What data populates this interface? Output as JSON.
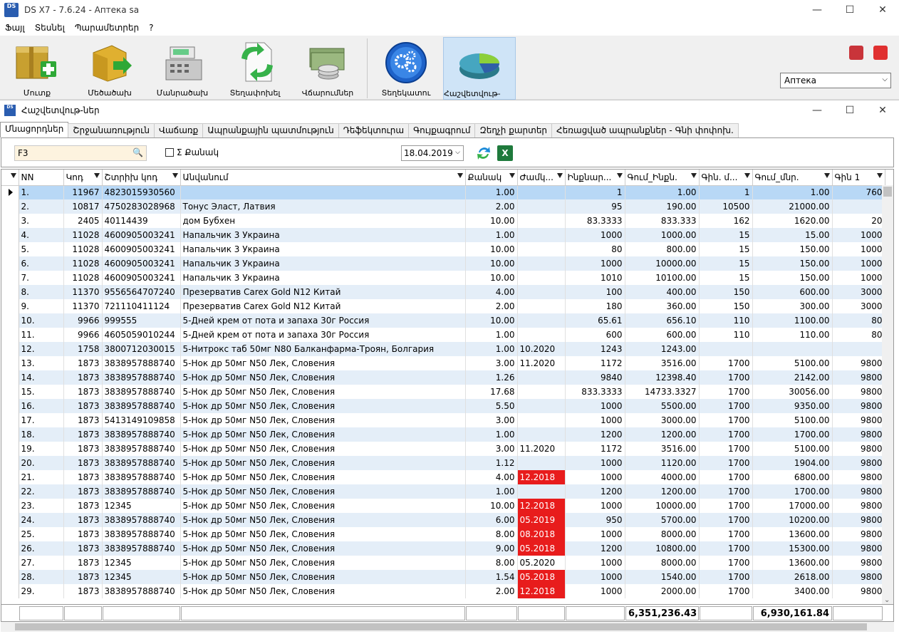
{
  "window": {
    "title": "DS X7 - 7.6.24 - Аптека sa",
    "logo": "DS",
    "controls": [
      "minimize-icon",
      "maximize-icon",
      "close-icon"
    ]
  },
  "menu": [
    "Ֆայլ",
    "Տեսնել",
    "Պարամետրեր",
    "?"
  ],
  "toolbar": [
    {
      "label": "Մուտք",
      "icon": "box-add-icon"
    },
    {
      "label": "Մեծածախ",
      "icon": "box-arrow-icon"
    },
    {
      "label": "Մանրածախ",
      "icon": "cash-register-icon"
    },
    {
      "label": "Տեղափոխել",
      "icon": "document-transfer-icon"
    },
    {
      "label": "Վճարումներ",
      "icon": "money-coins-icon"
    },
    {
      "label": "Տեղեկատու",
      "icon": "gears-icon"
    },
    {
      "label": "Հաշվետվութ-ներ",
      "icon": "pie-chart-icon",
      "active": true
    }
  ],
  "pharmacy_select": "Аптека",
  "child": {
    "title": "Հաշվետվութ-ներ"
  },
  "tabs": [
    "Մնացորդներ",
    "Շրջանառություն",
    "Վաճառք",
    "Ապրանքային պատմություն",
    "Դեֆեկտուրա",
    "Գույքագրում",
    "Զեղչի քարտեր",
    "Հեռացված ապրանքներ - Գնի փոփոխ."
  ],
  "filter": {
    "search_value": "F3",
    "sum_label": "Σ Քանակ",
    "date": "18.04.2019"
  },
  "columns": [
    "NN",
    "Կոդ",
    "Շտրիխ կոդ",
    "Անվանում",
    "Քանակ",
    "Ժամկ...",
    "Ինքնար...",
    "Գում_Ինքն.",
    "Գին. մ...",
    "Գում_մնր.",
    "Գին 1"
  ],
  "rows": [
    [
      "1.",
      "11967",
      "4823015930560",
      "",
      "1.00",
      "",
      "1",
      "1.00",
      "1",
      "1.00",
      "760"
    ],
    [
      "2.",
      "10817",
      "4750283028968",
      " Тонус Эласт, Латвия",
      "2.00",
      "",
      "95",
      "190.00",
      "10500",
      "21000.00",
      ""
    ],
    [
      "3.",
      "2405",
      "40114439",
      " дом  Бубхен",
      "10.00",
      "",
      "83.3333",
      "833.333",
      "162",
      "1620.00",
      "20"
    ],
    [
      "4.",
      "11028",
      "4600905003241",
      "Напальчик 3 Украина",
      "1.00",
      "",
      "1000",
      "1000.00",
      "15",
      "15.00",
      "1000"
    ],
    [
      "5.",
      "11028",
      "4600905003241",
      "Напальчик 3 Украина",
      "10.00",
      "",
      "80",
      "800.00",
      "15",
      "150.00",
      "1000"
    ],
    [
      "6.",
      "11028",
      "4600905003241",
      "Напальчик 3 Украина",
      "10.00",
      "",
      "1000",
      "10000.00",
      "15",
      "150.00",
      "1000"
    ],
    [
      "7.",
      "11028",
      "4600905003241",
      "Напальчик 3 Украина",
      "10.00",
      "",
      "1010",
      "10100.00",
      "15",
      "150.00",
      "1000"
    ],
    [
      "8.",
      "11370",
      "9556564707240",
      "Презерватив Carex Gold N12  Китай",
      "4.00",
      "",
      "100",
      "400.00",
      "150",
      "600.00",
      "3000"
    ],
    [
      "9.",
      "11370",
      "721110411124",
      "Презерватив Carex Gold N12  Китай",
      "2.00",
      "",
      "180",
      "360.00",
      "150",
      "300.00",
      "3000"
    ],
    [
      "10.",
      "9966",
      "999555",
      "5-Дней  крем  от  пота  и  запаха  30г  Россия",
      "10.00",
      "",
      "65.61",
      "656.10",
      "110",
      "1100.00",
      "80"
    ],
    [
      "11.",
      "9966",
      "4605059010244",
      "5-Дней  крем  от  пота  и  запаха  30г  Россия",
      "1.00",
      "",
      "600",
      "600.00",
      "110",
      "110.00",
      "80"
    ],
    [
      "12.",
      "1758",
      "3800712030015",
      "5-Нитрокс таб 50мг  N80  Балканфарма-Троян, Болгария",
      "1.00",
      "10.2020",
      "1243",
      "1243.00",
      "",
      "",
      ""
    ],
    [
      "13.",
      "1873",
      "3838957888740",
      "5-Нок др 50мг N50  Лек, Словения",
      "3.00",
      "11.2020",
      "1172",
      "3516.00",
      "1700",
      "5100.00",
      "9800"
    ],
    [
      "14.",
      "1873",
      "3838957888740",
      "5-Нок др 50мг N50  Лек, Словения",
      "1.26",
      "",
      "9840",
      "12398.40",
      "1700",
      "2142.00",
      "9800"
    ],
    [
      "15.",
      "1873",
      "3838957888740",
      "5-Нок др 50мг N50  Лек, Словения",
      "17.68",
      "",
      "833.3333",
      "14733.3327",
      "1700",
      "30056.00",
      "9800"
    ],
    [
      "16.",
      "1873",
      "3838957888740",
      "5-Нок др 50мг N50  Лек, Словения",
      "5.50",
      "",
      "1000",
      "5500.00",
      "1700",
      "9350.00",
      "9800"
    ],
    [
      "17.",
      "1873",
      "5413149109858",
      "5-Нок др 50мг N50  Лек, Словения",
      "3.00",
      "",
      "1000",
      "3000.00",
      "1700",
      "5100.00",
      "9800"
    ],
    [
      "18.",
      "1873",
      "3838957888740",
      "5-Нок др 50мг N50  Лек, Словения",
      "1.00",
      "",
      "1200",
      "1200.00",
      "1700",
      "1700.00",
      "9800"
    ],
    [
      "19.",
      "1873",
      "3838957888740",
      "5-Нок др 50мг N50  Лек, Словения",
      "3.00",
      "11.2020",
      "1172",
      "3516.00",
      "1700",
      "5100.00",
      "9800"
    ],
    [
      "20.",
      "1873",
      "3838957888740",
      "5-Нок др 50мг N50  Лек, Словения",
      "1.12",
      "",
      "1000",
      "1120.00",
      "1700",
      "1904.00",
      "9800"
    ],
    [
      "21.",
      "1873",
      "3838957888740",
      "5-Нок др 50мг N50  Лек, Словения",
      "4.00",
      "12.2018",
      "1000",
      "4000.00",
      "1700",
      "6800.00",
      "9800"
    ],
    [
      "22.",
      "1873",
      "3838957888740",
      "5-Нок др 50мг N50  Лек, Словения",
      "1.00",
      "",
      "1200",
      "1200.00",
      "1700",
      "1700.00",
      "9800"
    ],
    [
      "23.",
      "1873",
      "12345",
      "5-Нок др 50мг N50  Лек, Словения",
      "10.00",
      "12.2018",
      "1000",
      "10000.00",
      "1700",
      "17000.00",
      "9800"
    ],
    [
      "24.",
      "1873",
      "3838957888740",
      "5-Нок др 50мг N50  Лек, Словения",
      "6.00",
      "05.2019",
      "950",
      "5700.00",
      "1700",
      "10200.00",
      "9800"
    ],
    [
      "25.",
      "1873",
      "3838957888740",
      "5-Нок др 50мг N50  Лек, Словения",
      "8.00",
      "08.2018",
      "1000",
      "8000.00",
      "1700",
      "13600.00",
      "9800"
    ],
    [
      "26.",
      "1873",
      "3838957888740",
      "5-Нок др 50мг N50  Лек, Словения",
      "9.00",
      "05.2018",
      "1200",
      "10800.00",
      "1700",
      "15300.00",
      "9800"
    ],
    [
      "27.",
      "1873",
      "12345",
      "5-Нок др 50мг N50  Лек, Словения",
      "8.00",
      "05.2020",
      "1000",
      "8000.00",
      "1700",
      "13600.00",
      "9800"
    ],
    [
      "28.",
      "1873",
      "12345",
      "5-Нок др 50мг N50  Лек, Словения",
      "1.54",
      "05.2018",
      "1000",
      "1540.00",
      "1700",
      "2618.00",
      "9800"
    ],
    [
      "29.",
      "1873",
      "3838957888740",
      "5-Нок др 50мг N50  Лек, Словения",
      "2.00",
      "12.2018",
      "1000",
      "2000.00",
      "1700",
      "3400.00",
      "9800"
    ]
  ],
  "expired_rows": [
    21,
    23,
    24,
    25,
    26,
    28,
    29
  ],
  "totals": {
    "cost_sum": "6,351,236.43",
    "retail_sum": "6,930,161.84"
  },
  "colors": {
    "expired": "#e81c1c",
    "selected": "#b8d8f6",
    "alt_row": "#e4eef8"
  }
}
